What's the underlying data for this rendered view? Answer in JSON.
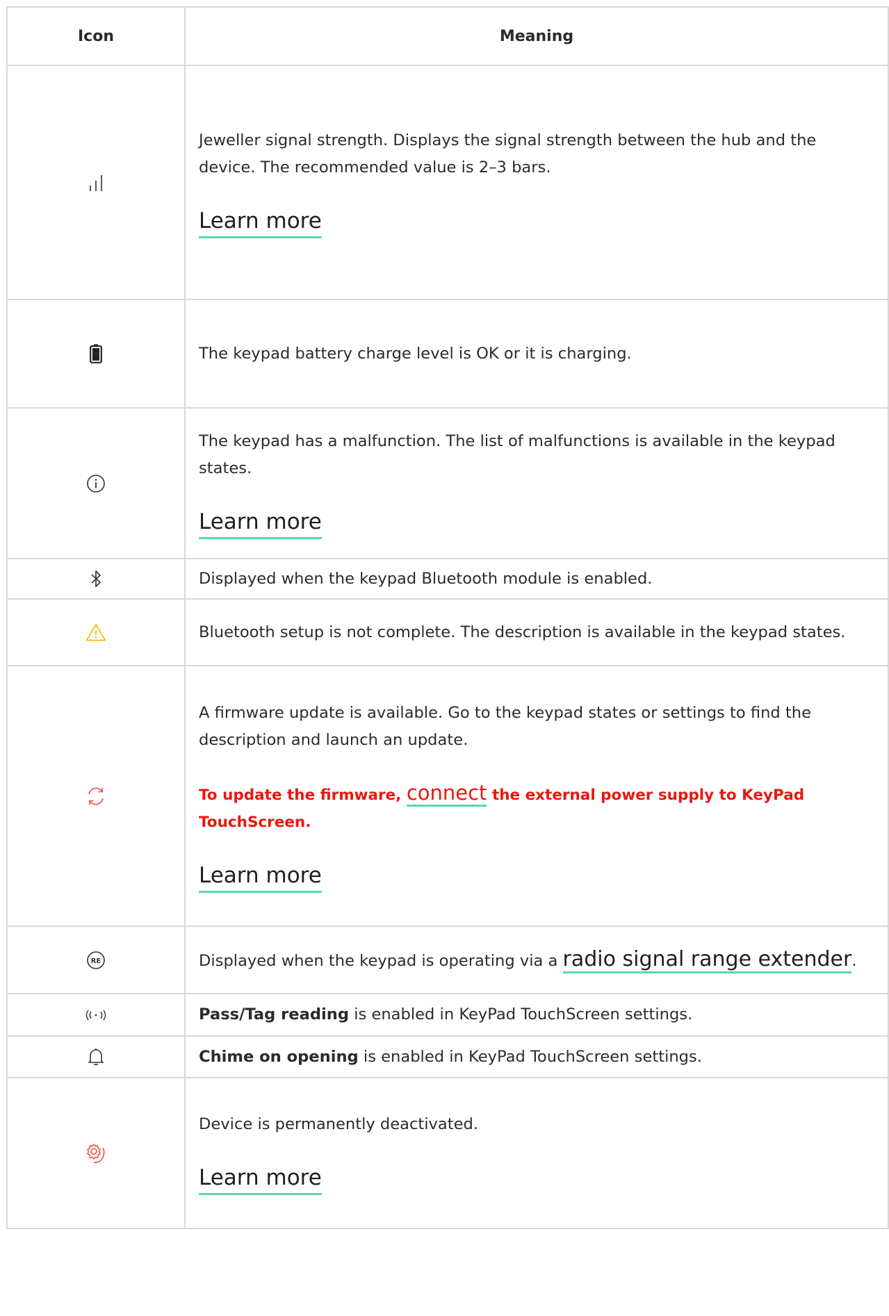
{
  "table": {
    "header_icon": "Icon",
    "header_meaning": "Meaning"
  },
  "rows": [
    {
      "icon": "signal-strength-icon",
      "text": "Jeweller signal strength. Displays the signal strength between the hub and the device. The recommended value is 2–3 bars.",
      "link": "Learn more"
    },
    {
      "icon": "battery-icon",
      "text": "The keypad battery charge level is OK or it is charging."
    },
    {
      "icon": "info-icon",
      "text": "The keypad has a malfunction. The list of malfunctions is available in the keypad states.",
      "link": "Learn more"
    },
    {
      "icon": "bluetooth-icon",
      "text": "Displayed when the keypad Bluetooth module is enabled."
    },
    {
      "icon": "warning-icon",
      "icon_color": "#f5b800",
      "text": "Bluetooth setup is not complete. The description is available in the keypad states."
    },
    {
      "icon": "firmware-update-icon",
      "icon_color": "#f25c4d",
      "text": "A firmware update is available. Go to the keypad states or settings to find the description and launch an update.",
      "warning_before": "To update the firmware,",
      "warning_link": "connect",
      "warning_after": "the external power supply to KeyPad TouchScreen.",
      "link": "Learn more"
    },
    {
      "icon": "range-extender-icon",
      "icon_label": "RE",
      "text_before": "Displayed when the keypad is operating via a",
      "text_link": "radio signal range extender",
      "text_after": "."
    },
    {
      "icon": "pass-tag-reading-icon",
      "bold": "Pass/Tag reading",
      "text_after": " is enabled in KeyPad TouchScreen settings."
    },
    {
      "icon": "chime-bell-icon",
      "bold": "Chime on opening",
      "text_after": " is enabled in KeyPad TouchScreen settings."
    },
    {
      "icon": "permanently-deactivated-icon",
      "icon_color": "#f25c4d",
      "text": "Device is permanently deactivated.",
      "link": "Learn more"
    }
  ],
  "colors": {
    "link_underline": "#59d9a7",
    "warning_text": "#e8180d",
    "border": "#d9d9d9"
  }
}
